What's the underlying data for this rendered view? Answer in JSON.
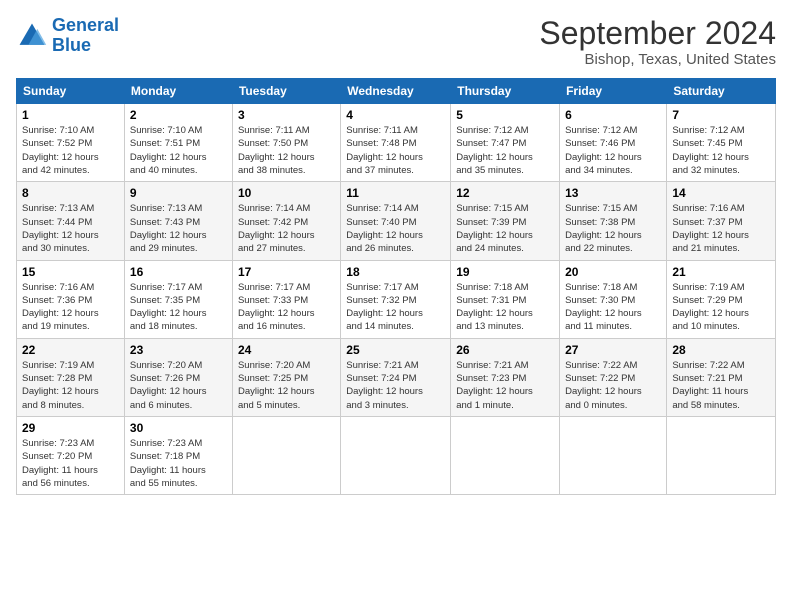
{
  "header": {
    "logo_line1": "General",
    "logo_line2": "Blue",
    "title": "September 2024",
    "subtitle": "Bishop, Texas, United States"
  },
  "columns": [
    "Sunday",
    "Monday",
    "Tuesday",
    "Wednesday",
    "Thursday",
    "Friday",
    "Saturday"
  ],
  "weeks": [
    [
      {
        "day": "1",
        "info": "Sunrise: 7:10 AM\nSunset: 7:52 PM\nDaylight: 12 hours\nand 42 minutes."
      },
      {
        "day": "2",
        "info": "Sunrise: 7:10 AM\nSunset: 7:51 PM\nDaylight: 12 hours\nand 40 minutes."
      },
      {
        "day": "3",
        "info": "Sunrise: 7:11 AM\nSunset: 7:50 PM\nDaylight: 12 hours\nand 38 minutes."
      },
      {
        "day": "4",
        "info": "Sunrise: 7:11 AM\nSunset: 7:48 PM\nDaylight: 12 hours\nand 37 minutes."
      },
      {
        "day": "5",
        "info": "Sunrise: 7:12 AM\nSunset: 7:47 PM\nDaylight: 12 hours\nand 35 minutes."
      },
      {
        "day": "6",
        "info": "Sunrise: 7:12 AM\nSunset: 7:46 PM\nDaylight: 12 hours\nand 34 minutes."
      },
      {
        "day": "7",
        "info": "Sunrise: 7:12 AM\nSunset: 7:45 PM\nDaylight: 12 hours\nand 32 minutes."
      }
    ],
    [
      {
        "day": "8",
        "info": "Sunrise: 7:13 AM\nSunset: 7:44 PM\nDaylight: 12 hours\nand 30 minutes."
      },
      {
        "day": "9",
        "info": "Sunrise: 7:13 AM\nSunset: 7:43 PM\nDaylight: 12 hours\nand 29 minutes."
      },
      {
        "day": "10",
        "info": "Sunrise: 7:14 AM\nSunset: 7:42 PM\nDaylight: 12 hours\nand 27 minutes."
      },
      {
        "day": "11",
        "info": "Sunrise: 7:14 AM\nSunset: 7:40 PM\nDaylight: 12 hours\nand 26 minutes."
      },
      {
        "day": "12",
        "info": "Sunrise: 7:15 AM\nSunset: 7:39 PM\nDaylight: 12 hours\nand 24 minutes."
      },
      {
        "day": "13",
        "info": "Sunrise: 7:15 AM\nSunset: 7:38 PM\nDaylight: 12 hours\nand 22 minutes."
      },
      {
        "day": "14",
        "info": "Sunrise: 7:16 AM\nSunset: 7:37 PM\nDaylight: 12 hours\nand 21 minutes."
      }
    ],
    [
      {
        "day": "15",
        "info": "Sunrise: 7:16 AM\nSunset: 7:36 PM\nDaylight: 12 hours\nand 19 minutes."
      },
      {
        "day": "16",
        "info": "Sunrise: 7:17 AM\nSunset: 7:35 PM\nDaylight: 12 hours\nand 18 minutes."
      },
      {
        "day": "17",
        "info": "Sunrise: 7:17 AM\nSunset: 7:33 PM\nDaylight: 12 hours\nand 16 minutes."
      },
      {
        "day": "18",
        "info": "Sunrise: 7:17 AM\nSunset: 7:32 PM\nDaylight: 12 hours\nand 14 minutes."
      },
      {
        "day": "19",
        "info": "Sunrise: 7:18 AM\nSunset: 7:31 PM\nDaylight: 12 hours\nand 13 minutes."
      },
      {
        "day": "20",
        "info": "Sunrise: 7:18 AM\nSunset: 7:30 PM\nDaylight: 12 hours\nand 11 minutes."
      },
      {
        "day": "21",
        "info": "Sunrise: 7:19 AM\nSunset: 7:29 PM\nDaylight: 12 hours\nand 10 minutes."
      }
    ],
    [
      {
        "day": "22",
        "info": "Sunrise: 7:19 AM\nSunset: 7:28 PM\nDaylight: 12 hours\nand 8 minutes."
      },
      {
        "day": "23",
        "info": "Sunrise: 7:20 AM\nSunset: 7:26 PM\nDaylight: 12 hours\nand 6 minutes."
      },
      {
        "day": "24",
        "info": "Sunrise: 7:20 AM\nSunset: 7:25 PM\nDaylight: 12 hours\nand 5 minutes."
      },
      {
        "day": "25",
        "info": "Sunrise: 7:21 AM\nSunset: 7:24 PM\nDaylight: 12 hours\nand 3 minutes."
      },
      {
        "day": "26",
        "info": "Sunrise: 7:21 AM\nSunset: 7:23 PM\nDaylight: 12 hours\nand 1 minute."
      },
      {
        "day": "27",
        "info": "Sunrise: 7:22 AM\nSunset: 7:22 PM\nDaylight: 12 hours\nand 0 minutes."
      },
      {
        "day": "28",
        "info": "Sunrise: 7:22 AM\nSunset: 7:21 PM\nDaylight: 11 hours\nand 58 minutes."
      }
    ],
    [
      {
        "day": "29",
        "info": "Sunrise: 7:23 AM\nSunset: 7:20 PM\nDaylight: 11 hours\nand 56 minutes."
      },
      {
        "day": "30",
        "info": "Sunrise: 7:23 AM\nSunset: 7:18 PM\nDaylight: 11 hours\nand 55 minutes."
      },
      {
        "day": "",
        "info": ""
      },
      {
        "day": "",
        "info": ""
      },
      {
        "day": "",
        "info": ""
      },
      {
        "day": "",
        "info": ""
      },
      {
        "day": "",
        "info": ""
      }
    ]
  ]
}
